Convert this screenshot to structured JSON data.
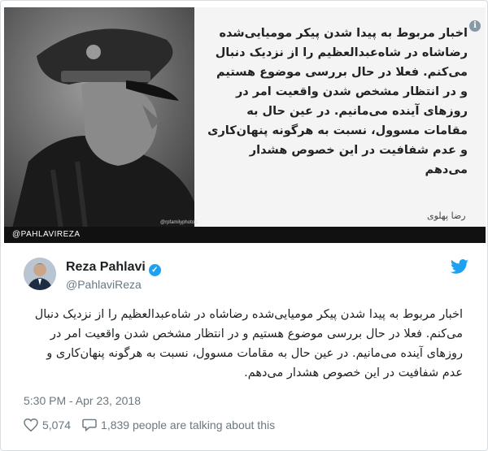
{
  "media": {
    "quote_text": "اخبار مربوط به پیدا شدن پیکر مومیایی‌شده رضاشاه در شاه‌عبدالعظیم را از نزدیک دنبال می‌کنم. فعلا در حال بررسی موضوع هستیم و در انتظار مشخص شدن واقعیت امر در روزهای آینده می‌مانیم. در عین حال به مقامات مسوول، نسبت به هرگونه پنهان‌کاری و عدم شفافیت در این خصوص هشدار می‌دهم",
    "signature": "رضا پهلوی",
    "photo_credit": "@rpfamilyphotos",
    "handle_bar": "@PAHLAVIREZA",
    "info_icon": "i"
  },
  "tweet": {
    "name": "Reza Pahlavi",
    "screen_name": "@PahlaviReza",
    "verified_mark": "✓",
    "text": "اخبار مربوط به پیدا شدن پیکر مومیایی‌شده رضاشاه در شاه‌عبدالعظیم را از نزدیک دنبال می‌کنم. فعلا در حال بررسی موضوع هستیم و در انتظار مشخص شدن واقعیت امر در روزهای آینده می‌مانیم. در عین حال به مقامات مسوول، نسبت به هرگونه پنهان‌کاری و عدم شفافیت در این خصوص هشدار می‌دهم.",
    "timestamp": "5:30 PM - Apr 23, 2018",
    "likes": "5,074",
    "replies_text": "1,839 people are talking about this"
  },
  "colors": {
    "twitter_blue": "#1da1f2",
    "muted": "#697882",
    "like_red": "#e0245e"
  }
}
